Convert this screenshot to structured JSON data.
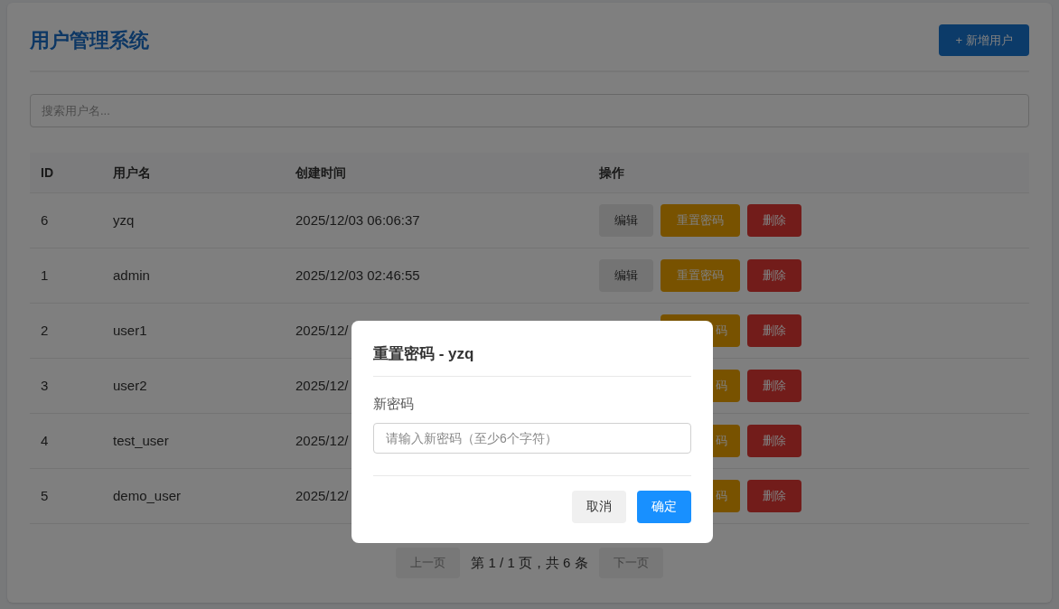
{
  "header": {
    "title": "用户管理系统",
    "add_button": "+ 新增用户"
  },
  "search": {
    "placeholder": "搜索用户名..."
  },
  "table": {
    "columns": [
      "ID",
      "用户名",
      "创建时间",
      "操作"
    ],
    "rows": [
      {
        "id": "6",
        "username": "yzq",
        "created": "2025/12/03 06:06:37",
        "actions": [
          {
            "kind": "edit",
            "label": "编辑"
          },
          {
            "kind": "reset",
            "label": "重置密码"
          },
          {
            "kind": "delete",
            "label": "删除"
          }
        ]
      },
      {
        "id": "1",
        "username": "admin",
        "created": "2025/12/03 02:46:55",
        "actions": [
          {
            "kind": "edit",
            "label": "编辑"
          },
          {
            "kind": "reset",
            "label": "重置密码"
          },
          {
            "kind": "delete",
            "label": "删除"
          }
        ]
      },
      {
        "id": "2",
        "username": "user1",
        "created": "2025/12/",
        "actions": [
          {
            "kind": "reset",
            "label": "码"
          },
          {
            "kind": "delete",
            "label": "删除"
          }
        ]
      },
      {
        "id": "3",
        "username": "user2",
        "created": "2025/12/",
        "actions": [
          {
            "kind": "reset",
            "label": "码"
          },
          {
            "kind": "delete",
            "label": "删除"
          }
        ]
      },
      {
        "id": "4",
        "username": "test_user",
        "created": "2025/12/",
        "actions": [
          {
            "kind": "reset",
            "label": "码"
          },
          {
            "kind": "delete",
            "label": "删除"
          }
        ]
      },
      {
        "id": "5",
        "username": "demo_user",
        "created": "2025/12/",
        "actions": [
          {
            "kind": "reset",
            "label": "码"
          },
          {
            "kind": "delete",
            "label": "删除"
          }
        ]
      }
    ]
  },
  "pagination": {
    "prev": {
      "label": "上一页",
      "disabled": true
    },
    "info": "第 1 / 1 页，共 6 条",
    "next": {
      "label": "下一页",
      "disabled": true
    }
  },
  "dialog": {
    "title": "重置密码 - yzq",
    "field_label": "新密码",
    "placeholder": "请输入新密码（至少6个字符）",
    "buttons": [
      {
        "kind": "cancel",
        "label": "取消"
      },
      {
        "kind": "confirm",
        "label": "确定"
      }
    ]
  }
}
